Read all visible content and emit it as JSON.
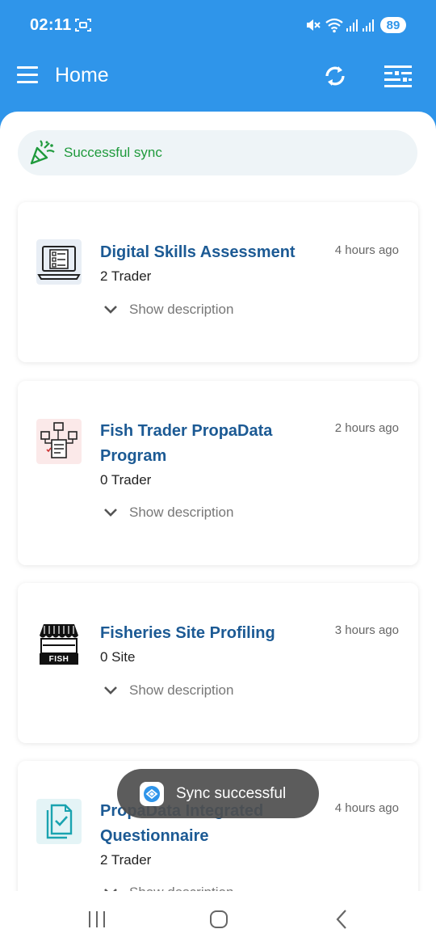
{
  "status_bar": {
    "time": "02:11",
    "battery": "89"
  },
  "app_bar": {
    "title": "Home",
    "menu_icon": "hamburger-icon",
    "sync_icon": "sync-icon",
    "filter_icon": "filter-icon"
  },
  "sync_banner": {
    "icon": "party-popper-icon",
    "text": "Successful sync",
    "color": "#1f9a3c"
  },
  "cards": [
    {
      "title": "Digital Skills Assessment",
      "subtitle": "2 Trader",
      "time": "4 hours ago",
      "action": "Show description",
      "icon": "laptop-checklist-icon"
    },
    {
      "title": "Fish Trader PropaData Program",
      "subtitle": "0 Trader",
      "time": "2 hours ago",
      "action": "Show description",
      "icon": "workflow-diagram-icon"
    },
    {
      "title": "Fisheries Site Profiling",
      "subtitle": "0 Site",
      "time": "3 hours ago",
      "action": "Show description",
      "icon": "fish-shop-icon",
      "icon_label": "FISH"
    },
    {
      "title": "PropaData Integrated Questionnaire",
      "subtitle": "2 Trader",
      "time": "4 hours ago",
      "action": "Show description",
      "icon": "document-check-icon"
    }
  ],
  "toast": {
    "text": "Sync successful",
    "icon": "app-logo-icon"
  },
  "colors": {
    "primary": "#2f95ea",
    "card_title": "#1c5a94",
    "success": "#1f9a3c"
  }
}
